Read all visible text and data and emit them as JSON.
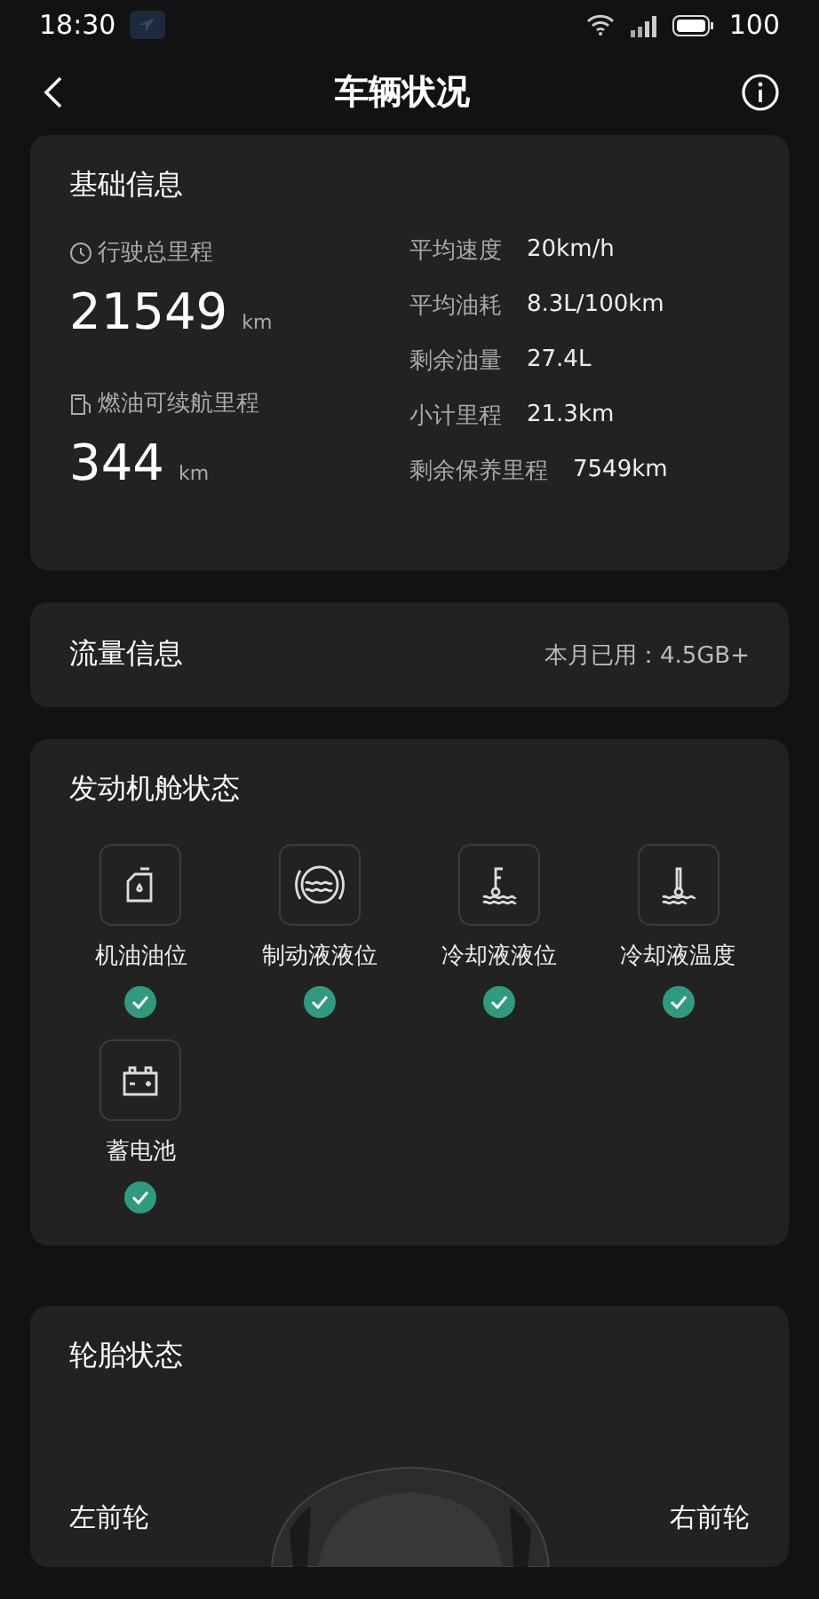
{
  "status_bar": {
    "time": "18:30",
    "battery": "100"
  },
  "header": {
    "title": "车辆状况"
  },
  "basic_info": {
    "title": "基础信息",
    "main": [
      {
        "kind": "odometer",
        "label": "行驶总里程",
        "value": "21549",
        "unit": "km"
      },
      {
        "kind": "fuel",
        "label": "燃油可续航里程",
        "value": "344",
        "unit": "km"
      }
    ],
    "stats": [
      {
        "label": "平均速度",
        "value": "20km/h"
      },
      {
        "label": "平均油耗",
        "value": "8.3L/100km"
      },
      {
        "label": "剩余油量",
        "value": "27.4L"
      },
      {
        "label": "小计里程",
        "value": "21.3km"
      },
      {
        "label": "剩余保养里程",
        "value": "7549km"
      }
    ]
  },
  "data_usage": {
    "title": "流量信息",
    "value": "本月已用：4.5GB+"
  },
  "engine_bay": {
    "title": "发动机舱状态",
    "items": [
      {
        "kind": "oil",
        "name": "机油油位",
        "ok": true
      },
      {
        "kind": "brake",
        "name": "制动液液位",
        "ok": true
      },
      {
        "kind": "coolant_level",
        "name": "冷却液液位",
        "ok": true
      },
      {
        "kind": "coolant_temp",
        "name": "冷却液温度",
        "ok": true
      },
      {
        "kind": "battery",
        "name": "蓄电池",
        "ok": true
      }
    ]
  },
  "tires": {
    "title": "轮胎状态",
    "left": "左前轮",
    "right": "右前轮"
  }
}
